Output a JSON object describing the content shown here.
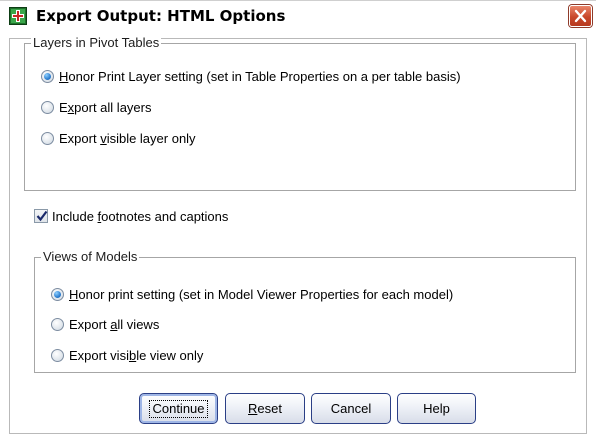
{
  "window": {
    "title": "Export Output: HTML Options"
  },
  "icons": {
    "app": "spss-app-icon",
    "close": "close-icon"
  },
  "layers_group": {
    "legend": "Layers in Pivot Tables",
    "options": [
      {
        "pre": "",
        "key": "H",
        "post": "onor Print Layer setting (set in Table Properties on a per table basis)",
        "selected": true
      },
      {
        "pre": "E",
        "key": "x",
        "post": "port all layers",
        "selected": false
      },
      {
        "pre": "Export ",
        "key": "v",
        "post": "isible layer only",
        "selected": false
      }
    ]
  },
  "footnotes": {
    "pre": "Include ",
    "key": "f",
    "post": "ootnotes and captions",
    "checked": true
  },
  "views_group": {
    "legend": "Views of Models",
    "options": [
      {
        "pre": "",
        "key": "H",
        "post": "onor print setting (set in Model Viewer Properties for each model)",
        "selected": true
      },
      {
        "pre": "Export ",
        "key": "a",
        "post": "ll views",
        "selected": false
      },
      {
        "pre": "Export visi",
        "key": "b",
        "post": "le view only",
        "selected": false
      }
    ]
  },
  "buttons": {
    "continue": "Continue",
    "reset_pre": "",
    "reset_key": "R",
    "reset_post": "eset",
    "cancel": "Cancel",
    "help": "Help"
  },
  "colors": {
    "close_red": "#c8472a",
    "radio_blue": "#2e7fd0",
    "button_border": "#2b3f86"
  }
}
